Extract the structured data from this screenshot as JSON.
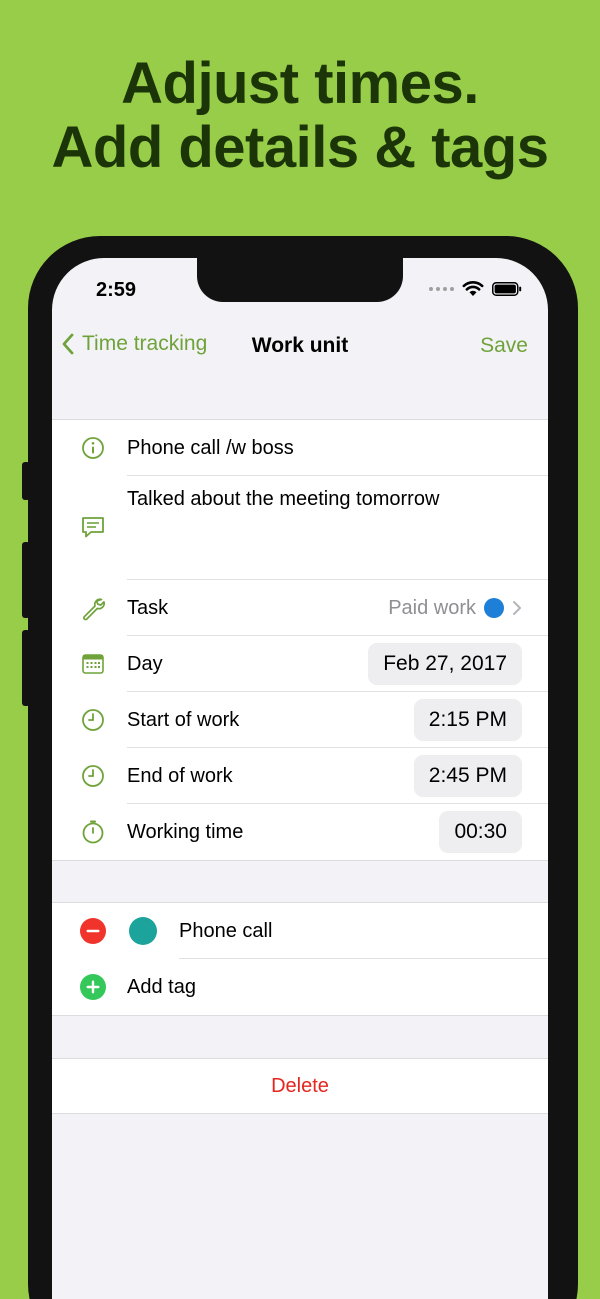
{
  "headline": {
    "line1": "Adjust times.",
    "line2": "Add details & tags"
  },
  "status_bar": {
    "time": "2:59"
  },
  "nav": {
    "back_label": "Time tracking",
    "title": "Work unit",
    "save_label": "Save"
  },
  "details": {
    "title": "Phone call /w boss",
    "note": "Talked about the meeting tomorrow",
    "task_label": "Task",
    "task_value": "Paid work",
    "task_color": "#1E7FD8",
    "day_label": "Day",
    "day_value": "Feb 27, 2017",
    "start_label": "Start of work",
    "start_value": "2:15 PM",
    "end_label": "End of work",
    "end_value": "2:45 PM",
    "duration_label": "Working time",
    "duration_value": "00:30"
  },
  "tags": {
    "items": [
      {
        "name": "Phone call",
        "color": "#1BA39C"
      }
    ],
    "add_label": "Add tag"
  },
  "actions": {
    "delete_label": "Delete"
  },
  "colors": {
    "background": "#97CD48",
    "accent": "#6FA33A",
    "headline": "#1B3508",
    "destructive": "#E5261E",
    "add": "#34C759"
  }
}
